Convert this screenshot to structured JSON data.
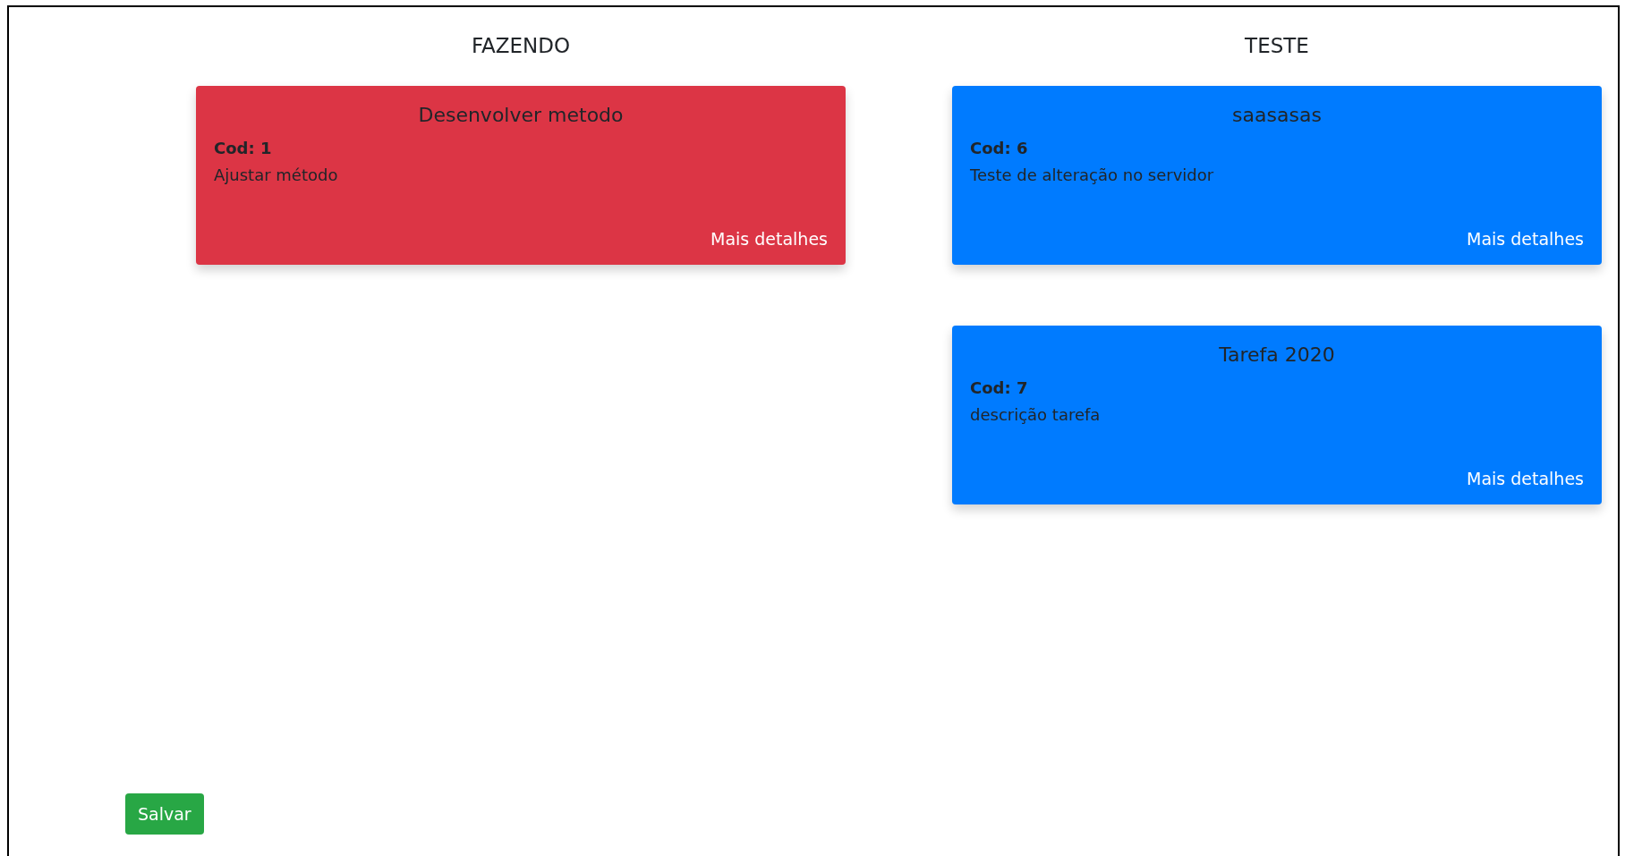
{
  "columns": [
    {
      "title": "FAZENDO",
      "cards": [
        {
          "title": "Desenvolver metodo",
          "code": "Cod: 1",
          "description": "Ajustar método",
          "link": "Mais detalhes",
          "color": "#dc3545"
        }
      ]
    },
    {
      "title": "TESTE",
      "cards": [
        {
          "title": "saasasas",
          "code": "Cod: 6",
          "description": "Teste de alteração no servidor",
          "link": "Mais detalhes",
          "color": "#007bff"
        },
        {
          "title": "Tarefa 2020",
          "code": "Cod: 7",
          "description": "descrição tarefa",
          "link": "Mais detalhes",
          "color": "#007bff"
        }
      ]
    }
  ],
  "save_button": "Salvar"
}
